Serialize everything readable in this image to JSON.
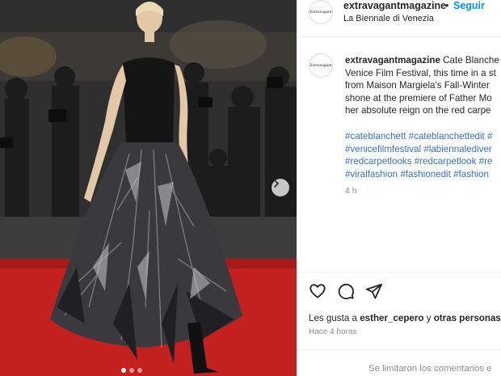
{
  "post": {
    "username": "extravagantmagazine",
    "separator": "•",
    "follow_label": "Seguir",
    "location": "La Biennale di Venezia",
    "avatar_text": "Extravagant",
    "caption_lines": [
      "Cate Blanche",
      "Venice Film Festival, this time in a st",
      "from Maison Margiela's Fall-Winter",
      "shone at the premiere of Father Mo",
      "her absolute reign on the red carpe"
    ],
    "hashtag_lines": [
      [
        "#cateblanchett",
        "#cateblanchettedit",
        "#"
      ],
      [
        "#venicefilmfestival",
        "#labiennalediver"
      ],
      [
        "#redcarpetlooks",
        "#redcarpetlook",
        "#re"
      ],
      [
        "#viralfashion",
        "#fashionedit",
        "#fashion"
      ]
    ],
    "caption_time": "4 h",
    "likes_prefix": "Les gusta a",
    "likes_user": "esther_cepero",
    "likes_conj": "y",
    "likes_others": "otras personas",
    "posted_ago": "Hace 4 horas",
    "comments_notice": "Se limitaron los comentarios e"
  },
  "icons": {
    "like": "heart-icon",
    "comment": "comment-icon",
    "share": "share-icon",
    "next": "chevron-right-icon"
  },
  "carousel": {
    "slide_count": 3,
    "active_index": 0
  },
  "colors": {
    "follow_blue": "#0095f6",
    "hashtag_blue": "#3a6fc4",
    "carpet_red": "#c2211f",
    "muted": "#8e8e8e"
  }
}
